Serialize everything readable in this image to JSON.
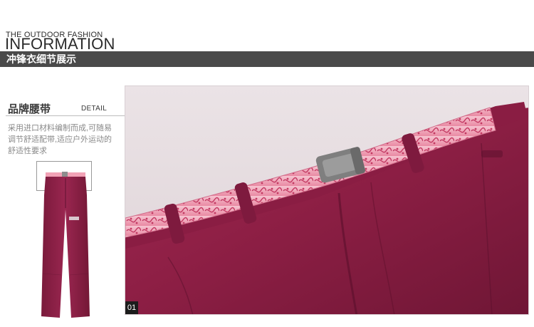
{
  "header": {
    "brand_tagline": "THE OUTDOOR FASHION",
    "brand_heading": "INFORMATION"
  },
  "section": {
    "title": "冲锋衣细节展示"
  },
  "detail": {
    "heading": "品牌腰带",
    "heading_en": "DETAIL",
    "description": "采用进口材料编制而成,可随易调节舒适配带,适应户外运动的舒适性要求"
  },
  "photo": {
    "number": "01",
    "colors": {
      "fabric": "#8e1f45",
      "belt": "#f2a2b6",
      "buckle": "#7f7f7f",
      "background": "#e6dde1"
    }
  }
}
